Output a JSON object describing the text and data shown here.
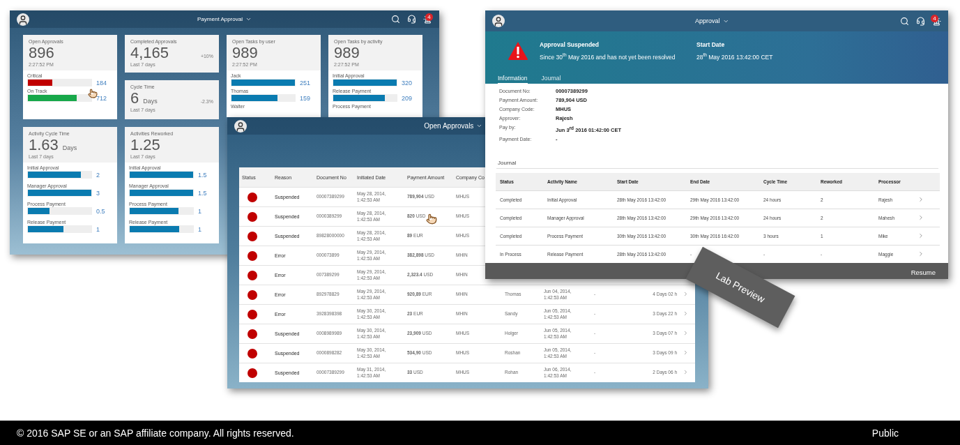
{
  "dashboard_window": {
    "title": "Payment Approval",
    "notification_count": "4",
    "tiles": [
      {
        "kind": "bars",
        "title": "Open Approvals",
        "value": "896",
        "subtitle": "2:27:52 PM",
        "bars": [
          {
            "label": "Critical",
            "level": 0.38,
            "reading": "184",
            "color": "#c00000"
          },
          {
            "label": "On Track",
            "level": 0.77,
            "reading": "712",
            "color": "#17a84a"
          }
        ]
      },
      {
        "kind": "kpi",
        "title": "Completed Approvals",
        "value": "4,165",
        "delta": "+10%",
        "subtitle": "Last 7 days"
      },
      {
        "kind": "kpi",
        "title": "Cycle Time",
        "value": "6",
        "unit": "Days",
        "delta": "-2.3%",
        "subtitle": "Last 7 days"
      },
      {
        "kind": "bars",
        "title": "Open Tasks by user",
        "value": "989",
        "subtitle": "2:27:52 PM",
        "bars": [
          {
            "label": "Jack",
            "level": 1,
            "reading": "251"
          },
          {
            "label": "Thomas",
            "level": 0.73,
            "reading": "159"
          },
          {
            "label": "Walter"
          }
        ]
      },
      {
        "kind": "bars",
        "title": "Open Tasks by activity",
        "value": "989",
        "subtitle": "2:27:52 PM",
        "bars": [
          {
            "label": "Initial Approval",
            "level": 1,
            "reading": "320"
          },
          {
            "label": "Release Payment",
            "level": 0.81,
            "reading": "209"
          },
          {
            "label": "Process Payment"
          }
        ]
      },
      {
        "kind": "bars",
        "title": "Activity Cycle Time",
        "value": "1.63",
        "unit": "Days",
        "subtitle": "Last 7 days",
        "bars": [
          {
            "label": "Initial Approval",
            "level": 0.84,
            "reading": "2"
          },
          {
            "label": "Manager Approval",
            "level": 1,
            "reading": "3"
          },
          {
            "label": "Process Payment",
            "level": 0.34,
            "reading": "0.5"
          },
          {
            "label": "Release Payment",
            "level": 0.56,
            "reading": "1"
          }
        ]
      },
      {
        "kind": "bars",
        "title": "Activities Reworked",
        "value": "1.25",
        "subtitle": "Last 7 days",
        "bars": [
          {
            "label": "Initial Approval",
            "level": 1,
            "reading": "1.5"
          },
          {
            "label": "Manager Approval",
            "level": 1,
            "reading": "1.5"
          },
          {
            "label": "Process Payment",
            "level": 0.77,
            "reading": "1"
          },
          {
            "label": "Release Payment",
            "level": 0.78,
            "reading": "1"
          }
        ]
      }
    ]
  },
  "approvals_window": {
    "title": "Open Approvals",
    "columns": [
      "Status",
      "Reason",
      "Document No",
      "Initiated Date",
      "Payment Amount",
      "Company Co"
    ],
    "rows": [
      {
        "color": "#c00000",
        "reason": "Suspended",
        "document_no": "00007389299",
        "initiated_date": [
          "May 28, 2014,",
          "1:42:53 AM"
        ],
        "amount": "**789,904** USD",
        "company": "MHUS"
      },
      {
        "color": "#c00000",
        "reason": "Suspended",
        "document_no": "0000389299",
        "initiated_date": [
          "May 28, 2014,",
          "1:42:53 AM"
        ],
        "amount": "**820** USD",
        "company": "MHUS"
      },
      {
        "color": "#c00000",
        "reason": "Suspended",
        "document_no": "89828000000",
        "initiated_date": [
          "May 28, 2014,",
          "1:42:53 AM"
        ],
        "amount": "**89** EUR",
        "company": "MHUS"
      },
      {
        "color": "#c00000",
        "reason": "Error",
        "document_no": "000073899",
        "initiated_date": [
          "May 29, 2014,",
          "1:42:53 AM"
        ],
        "amount": "**382,898** USD",
        "company": "MHIN"
      },
      {
        "color": "#c00000",
        "reason": "Error",
        "document_no": "007389299",
        "initiated_date": [
          "May 29, 2014,",
          "1:42:53 AM"
        ],
        "amount": "**2,323.4** USD",
        "company": "MHIN"
      },
      {
        "color": "#c00000",
        "reason": "Error",
        "document_no": "892978829",
        "initiated_date": [
          "May 29, 2014,",
          "1:42:53 AM"
        ],
        "amount": "**920,89** EUR",
        "company": "MHIN",
        "processor": "Thomas",
        "due_date": [
          "Jun 04, 2014,",
          "1:42:53 AM"
        ],
        "column_9": "-",
        "duration": "4 Days 02 h"
      },
      {
        "color": "#c00000",
        "reason": "Error",
        "document_no": "3928398398",
        "initiated_date": [
          "May 30, 2014,",
          "1:42:53 AM"
        ],
        "amount": "**23** EUR",
        "company": "MHIN",
        "processor": "Sandy",
        "due_date": [
          "Jun 05, 2014,",
          "1:42:53 AM"
        ],
        "column_9": "-",
        "duration": "3 Days 22 h"
      },
      {
        "color": "#c00000",
        "reason": "Suspended",
        "document_no": "0008989989",
        "initiated_date": [
          "May 30, 2014,",
          "1:42:53 AM"
        ],
        "amount": "**23,909** USD",
        "company": "MHUS",
        "processor": "Holger",
        "due_date": [
          "Jun 05, 2014,",
          "1:42:53 AM"
        ],
        "column_9": "-",
        "duration": "3 Days 07 h"
      },
      {
        "color": "#c00000",
        "reason": "Suspended",
        "document_no": "0000898282",
        "initiated_date": [
          "May 30, 2014,",
          "1:42:53 AM"
        ],
        "amount": "**534,90** USD",
        "company": "MHUS",
        "processor": "Roshan",
        "due_date": [
          "Jun 05, 2014,",
          "1:42:53 AM"
        ],
        "column_9": "-",
        "duration": "3 Days 09 h"
      },
      {
        "color": "#c00000",
        "reason": "Suspended",
        "document_no": "00007389299",
        "initiated_date": [
          "May 31, 2014,",
          "1:42:53 AM"
        ],
        "amount": "**33** USD",
        "company": "MHUS",
        "processor": "Rohan",
        "due_date": [
          "Jun 06, 2014,",
          "1:42:53 AM"
        ],
        "column_9": "-",
        "duration": "2 Days 06 h"
      }
    ]
  },
  "detail_window": {
    "title": "Approval",
    "notification_count": "4",
    "alert": {
      "title": "Approval Suspended",
      "text": "Since 30$^{th}$ May 2016 and has not yet been resolved"
    },
    "start": {
      "label": "Start Date",
      "value": "28$^{th}$ May 2016 13:42:00 CET"
    },
    "tabs": [
      {
        "label": "Information",
        "selected": true
      },
      {
        "label": "Journal",
        "selected": false
      }
    ],
    "fields": [
      {
        "label": "Document No:",
        "value": "00007389299"
      },
      {
        "label": "Payment Amount:",
        "value": "789,904 USD"
      },
      {
        "label": "Company Code:",
        "value": "MHUS"
      },
      {
        "label": "Approver:",
        "value": "Rajesh"
      },
      {
        "label": "Pay by:",
        "value": "Jun 3$^{rd}$ 2016 01:42:00 CET"
      },
      {
        "label": "Payment Date:",
        "value": "-"
      }
    ],
    "journal": {
      "title": "Journal",
      "columns": [
        "Status",
        "Activity Name",
        "Start Date",
        "End Date",
        "Cycle Time",
        "Reworked",
        "Processor"
      ],
      "rows": [
        [
          "Completed",
          "Initial Approval",
          "28th May 2016 13:42:00",
          "29th May 2016 13:42:00",
          "24 hours",
          "2",
          "Rajesh"
        ],
        [
          "Completed",
          "Manager Approval",
          "28th May 2016 13:42:00",
          "29th May 2016 13:42:00",
          "24 hours",
          "2",
          "Mahesh"
        ],
        [
          "Completed",
          "Process Payment",
          "30th May 2016 13:42:00",
          "30th May 2016 16:42:00",
          "3 hours",
          "1",
          "Mike"
        ],
        [
          "In Process",
          "Release Payment",
          "28th May 2016 13:42:00",
          "-",
          "-",
          "-",
          "Maggie"
        ]
      ]
    },
    "action": "Resume"
  },
  "badge": "Lab Preview",
  "footer": {
    "copyright": "© 2016 SAP SE or an SAP affiliate company. All rights reserved.",
    "classification": "Public"
  }
}
